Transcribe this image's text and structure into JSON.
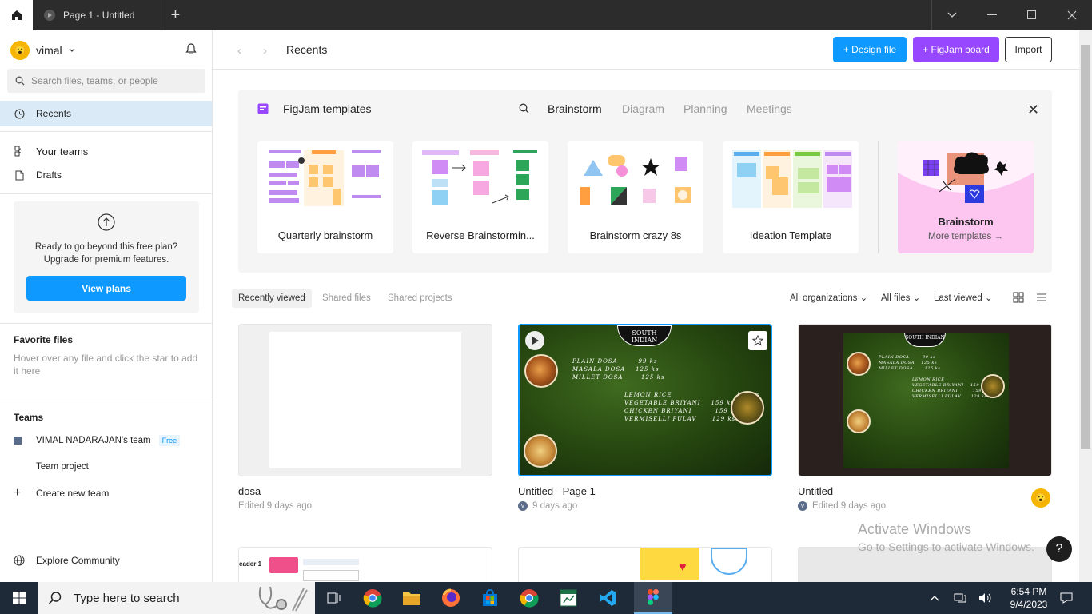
{
  "titlebar": {
    "tab_title": "Page 1 - Untitled"
  },
  "sidebar": {
    "user_name": "vimal",
    "search_placeholder": "Search files, teams, or people",
    "nav": {
      "recents": "Recents",
      "your_teams": "Your teams",
      "drafts": "Drafts"
    },
    "upgrade": {
      "text_line1": "Ready to go beyond this free plan?",
      "text_line2": "Upgrade for premium features.",
      "button": "View plans"
    },
    "favorites": {
      "title": "Favorite files",
      "hint": "Hover over any file and click the star to add it here"
    },
    "teams": {
      "title": "Teams",
      "team_name": "VIMAL NADARAJAN's team",
      "team_badge": "Free",
      "project": "Team project",
      "create": "Create new team"
    },
    "explore": "Explore Community"
  },
  "header": {
    "title": "Recents",
    "design_file": "+ Design file",
    "figjam_board": "+ FigJam board",
    "import": "Import"
  },
  "templates": {
    "title": "FigJam templates",
    "filters": [
      "Brainstorm",
      "Diagram",
      "Planning",
      "Meetings"
    ],
    "active_filter": "Brainstorm",
    "cards": [
      "Quarterly brainstorm",
      "Reverse Brainstormin...",
      "Brainstorm crazy 8s",
      "Ideation Template"
    ],
    "more": {
      "title": "Brainstorm",
      "link": "More templates →"
    }
  },
  "file_tabs": [
    "Recently viewed",
    "Shared files",
    "Shared projects"
  ],
  "dropdowns": {
    "org": "All organizations",
    "files": "All files",
    "sort": "Last viewed"
  },
  "files": [
    {
      "name": "dosa",
      "meta": "Edited 9 days ago"
    },
    {
      "name": "Untitled - Page 1",
      "meta": "9 days ago",
      "avatar": "V"
    },
    {
      "name": "Untitled",
      "meta": "Edited 9 days ago",
      "avatar": "V"
    }
  ],
  "menu": {
    "logo": "SOUTH INDIAN",
    "items_a": "PLAIN DOSA        99 ks\nMASALA DOSA    125 ks\nMILLET DOSA       125 ks",
    "items_b": "LEMON RICE                         125 ks\nVEGETABLE BRIYANI    159 ks\nCHICKEN BRIYANI         159 ks\nVERMISELLI PULAV      129 ks"
  },
  "row2_label": "eader 1",
  "watermark": {
    "line1": "Activate Windows",
    "line2": "Go to Settings to activate Windows."
  },
  "help": "?",
  "taskbar": {
    "search_placeholder": "Type here to search",
    "time": "6:54 PM",
    "date": "9/4/2023"
  },
  "colors": {
    "accent_blue": "#0d99ff",
    "figjam_purple": "#9747ff",
    "selected_nav": "#daebf7"
  }
}
